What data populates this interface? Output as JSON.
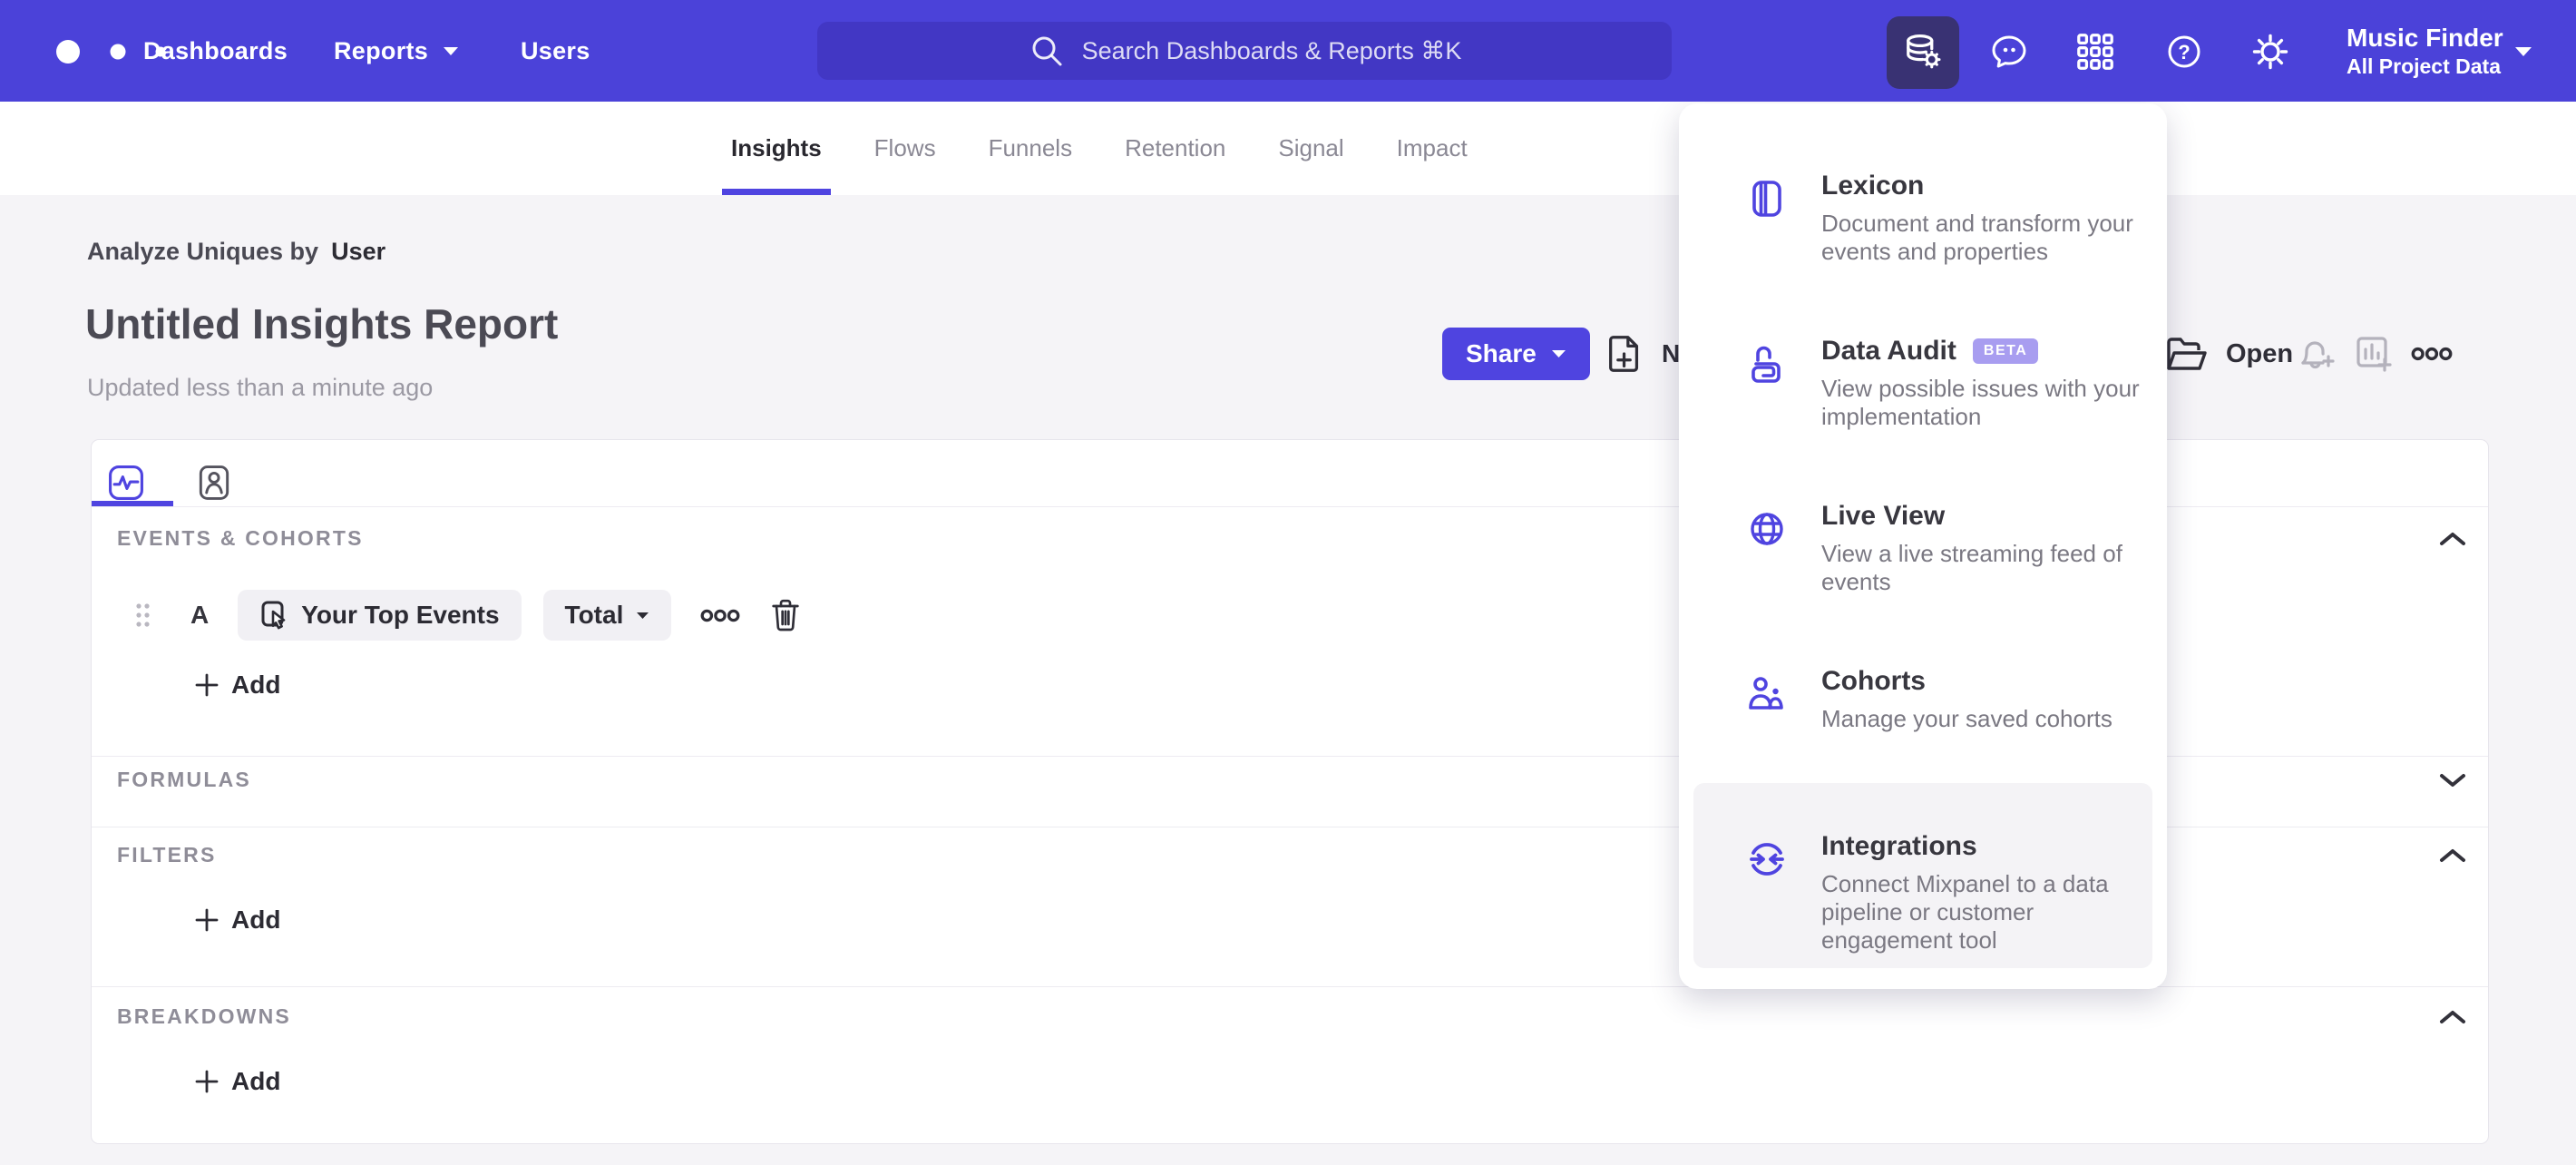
{
  "nav": {
    "items": [
      "Dashboards",
      "Reports",
      "Users"
    ],
    "search_placeholder": "Search Dashboards & Reports ⌘K",
    "project": {
      "name": "Music Finder",
      "scope": "All Project Data"
    }
  },
  "tabs": {
    "items": [
      "Insights",
      "Flows",
      "Funnels",
      "Retention",
      "Signal",
      "Impact"
    ],
    "active": "Insights"
  },
  "report": {
    "analyze_label": "Analyze Uniques by",
    "analyze_value": "User",
    "title": "Untitled Insights Report",
    "updated": "Updated less than a minute ago",
    "share_label": "Share",
    "new_label": "New Report",
    "open_label": "Open"
  },
  "builder": {
    "events": {
      "label": "EVENTS & COHORTS",
      "series_letter": "A",
      "event_name": "Your Top Events",
      "metric": "Total",
      "add_label": "Add"
    },
    "formulas": {
      "label": "FORMULAS"
    },
    "filters": {
      "label": "FILTERS",
      "add_label": "Add"
    },
    "breakdowns": {
      "label": "BREAKDOWNS",
      "add_label": "Add"
    }
  },
  "menu": {
    "items": [
      {
        "title": "Lexicon",
        "desc": "Document and transform your events and properties"
      },
      {
        "title": "Data Audit",
        "badge": "BETA",
        "desc": "View possible issues with your implementation"
      },
      {
        "title": "Live View",
        "desc": "View a live streaming feed of events"
      },
      {
        "title": "Cohorts",
        "desc": "Manage your saved cohorts"
      },
      {
        "title": "Integrations",
        "desc": "Connect Mixpanel to a data pipeline or customer engagement tool"
      }
    ]
  },
  "icons": {
    "logo": "three-dots",
    "search": "magnifier",
    "data_management": "database-gear",
    "messages": "chat-bubble",
    "apps": "grid-3x3",
    "help": "question-circle",
    "settings": "gear",
    "new_report": "page-plus",
    "open": "folder",
    "alert": "bell-plus",
    "add_to_board": "chart-plus",
    "more": "three-circles",
    "lexicon": "book",
    "data_audit": "lock-spiral",
    "live_view": "globe",
    "cohorts": "people",
    "integrations": "sync-arrows"
  },
  "colors": {
    "nav_background": "#4b42d9",
    "search_background": "#4237c4",
    "active_chip_background": "#393273",
    "accent": "#4f44e0",
    "page_background": "#f5f4f7",
    "beta_badge": "#a89df0",
    "menu_highlight": "#f4f3f6"
  }
}
